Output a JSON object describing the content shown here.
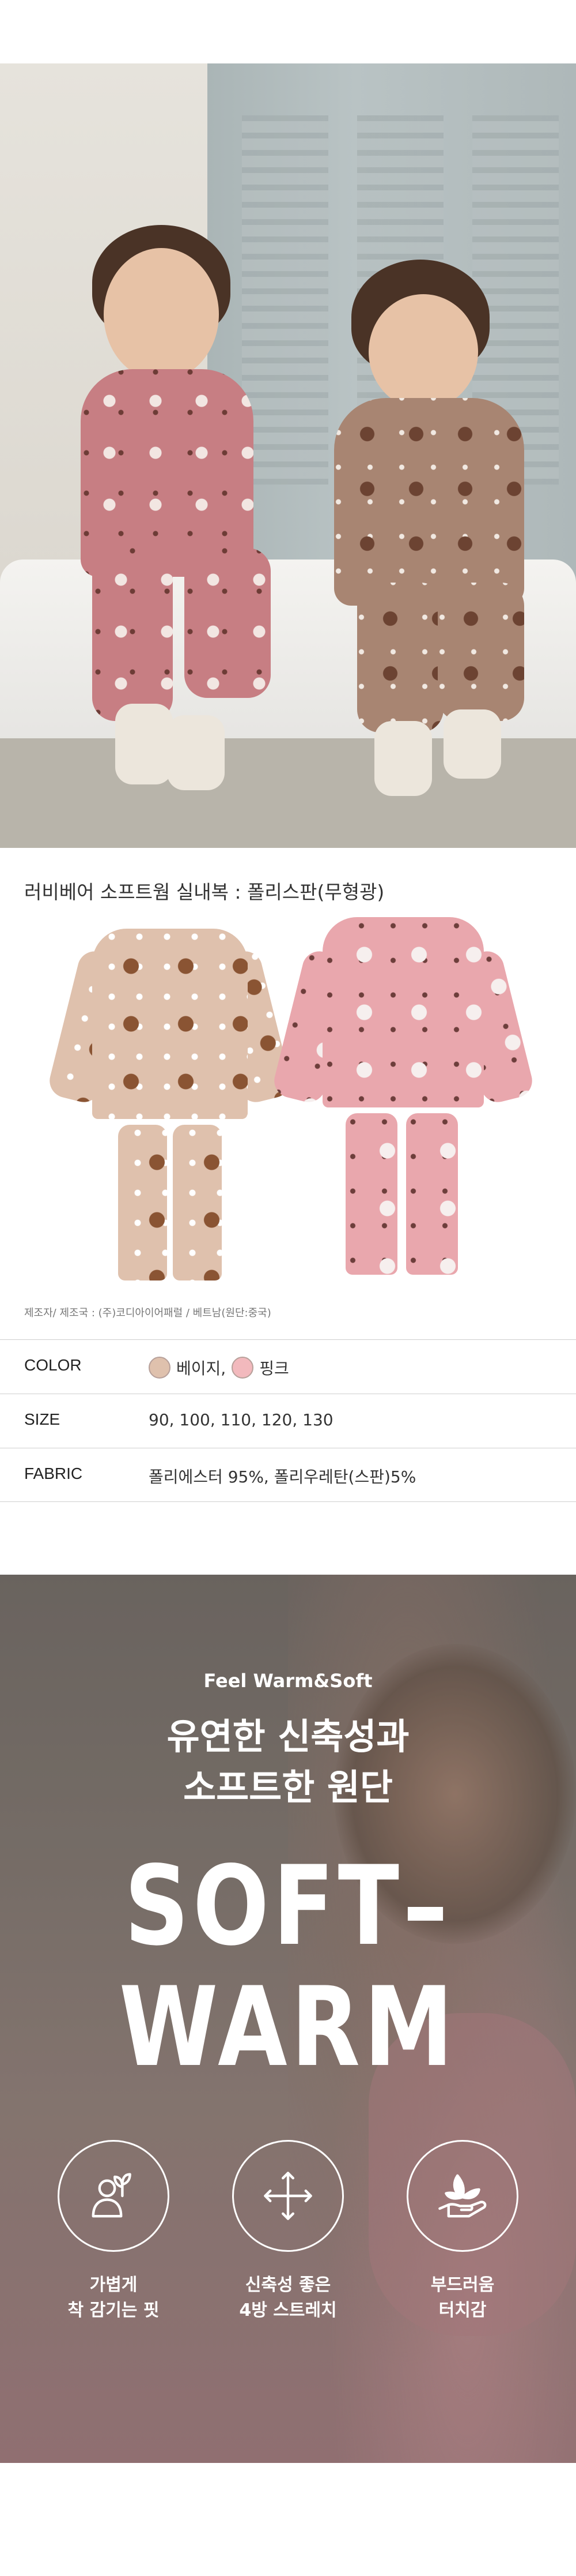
{
  "product": {
    "title": "러비베어 소프트웜 실내복 : 폴리스판(무형광)",
    "maker": "제조자/ 제조국 : (주)코디아이어패럴 / 베트남(원단:중국)"
  },
  "specs": {
    "color": {
      "label": "COLOR",
      "options": [
        "베이지,",
        "핑크"
      ],
      "swatches": [
        "#dfc1ad",
        "#f2b9bd"
      ]
    },
    "size": {
      "label": "SIZE",
      "value": "90, 100, 110, 120, 130"
    },
    "fabric": {
      "label": "FABRIC",
      "value": "폴리에스터 95%, 폴리우레탄(스판)5%"
    }
  },
  "feature": {
    "tagline": "Feel Warm&Soft",
    "headline_1": "유연한 신축성과",
    "headline_2": "소프트한 원단",
    "big_1": "SOFT–",
    "big_2": "WARM",
    "icons": [
      {
        "icon": "person-sprout-icon",
        "line1": "가볍게",
        "line2": "착 감기는 핏"
      },
      {
        "icon": "four-way-arrows-icon",
        "line1": "신축성 좋은",
        "line2": "4방 스트레치"
      },
      {
        "icon": "hand-leaf-icon",
        "line1": "부드러움",
        "line2": "터치감"
      }
    ]
  },
  "colors": {
    "text": "#222222",
    "divider": "#cfcfcf",
    "banner_text": "#ffffff"
  }
}
